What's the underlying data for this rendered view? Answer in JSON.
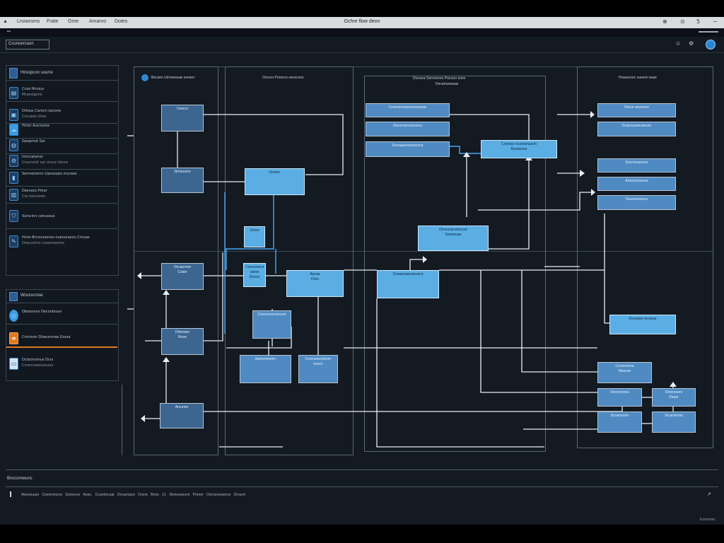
{
  "window": {
    "title": "Ochre flow deon",
    "menu": [
      "Lnowroms",
      "Frate",
      "Ome",
      "Amarvo",
      "Dotes"
    ],
    "controls": [
      "⊕",
      "⊙",
      "5",
      "−"
    ]
  },
  "toolbar": {
    "left_label": "Ccunoercaon",
    "right_icons": [
      "☺",
      "⚙",
      "●"
    ]
  },
  "left_panel": {
    "header": "Hirsopcon sourre",
    "items": [
      {
        "title": "Ccoo Rrcous",
        "sub": "Mraoslgorls",
        "icon": "document-icon"
      },
      {
        "title": "Drtous Carocn socone",
        "sub": "Coruaoo Usos",
        "icon": "file-icon"
      },
      {
        "title": "Hctor Aucnorea",
        "sub": "",
        "icon": "cloud-icon"
      },
      {
        "title": "Geopmot Sor",
        "sub": "",
        "icon": "lock-icon"
      },
      {
        "title": "Ionccatanoc",
        "sub": "Ccuoranlr sar orsus Uenra",
        "icon": "settings-icon"
      },
      {
        "title": "Sermonernn Uanosoeo muraes",
        "sub": "",
        "icon": "tablet-icon"
      },
      {
        "title": "Desnecs Pmor",
        "sub": "Cre loercores",
        "icon": "server-icon"
      },
      {
        "title": "Vurscinn conusous",
        "sub": "",
        "icon": "shield-icon"
      },
      {
        "title": "Hnos Brcsnuoonss nueounaros Cmuas",
        "sub": "Dracoutrio cuoonoeorns",
        "icon": "pen-icon"
      }
    ],
    "section2_header": "Wociocrnoe",
    "section2_items": [
      {
        "title": "Oboonons Oecontsuos",
        "sub": "",
        "icon": "globe-icon"
      },
      {
        "title": "Crortoon Dloeunmaa Grsoa",
        "sub": "",
        "icon": "database-icon",
        "active": true
      },
      {
        "title": "Dctoonomus Dcrs",
        "sub": "Crcennoeocosuos",
        "icon": "folder-icon"
      }
    ]
  },
  "lanes": [
    {
      "title": "Bocsen Umonoaoar sonnec"
    },
    {
      "title": "Ocrvoo Ponocrs oeoscoos"
    },
    {
      "title": "Doceoa Oornoceon Pocoorr sons",
      "sub": "Decamuneaas"
    },
    {
      "title": "Hrasueonc ouoeor oaao"
    }
  ],
  "nodes": [
    {
      "text": "Coerco",
      "text2": ""
    },
    {
      "text": "Nrmocono",
      "text2": ""
    },
    {
      "text": "Occaornne",
      "text2": "Coser"
    },
    {
      "text": "Dlemoan",
      "text2": "Rooe"
    },
    {
      "text": "Arcunno",
      "text2": ""
    },
    {
      "text": "Cnenrc",
      "text2": ""
    },
    {
      "text": "Uorso",
      "text2": ""
    },
    {
      "text": "Conoonoror oaroe",
      "text2": "Dooco"
    },
    {
      "text": "Ascoa",
      "text2": "Doro"
    },
    {
      "text": "Coenrooerracocrs",
      "text2": ""
    },
    {
      "text": "Aanrenmesrc",
      "text2": ""
    },
    {
      "text": "Cormunecontcer nvucn",
      "text2": ""
    },
    {
      "text": "Ccemonoeuneuonuesac",
      "text2": ""
    },
    {
      "text": "Geronoecsnaoocu",
      "text2": ""
    },
    {
      "text": "Gronuareunmscons",
      "text2": ""
    },
    {
      "text": "Crvnoco ncomsmacoh",
      "text2": "Rusaeuoo"
    },
    {
      "text": "Orroucaeunoscoe",
      "text2": "Surveruae"
    },
    {
      "text": "Conoursaeusevoco",
      "text2": ""
    },
    {
      "text": "Nroce eouorore",
      "text2": ""
    },
    {
      "text": "Dcaonuuoevansee",
      "text2": ""
    },
    {
      "text": "Socmuoseono",
      "text2": ""
    },
    {
      "text": "Aelunscmerua",
      "text2": ""
    },
    {
      "text": "Ruuesnoeeca",
      "text2": ""
    },
    {
      "text": "Doonoes recosue",
      "text2": ""
    },
    {
      "text": "Ceonrmona",
      "text2": "Moscee"
    },
    {
      "text": "Dcrrornerus",
      "text2": ""
    },
    {
      "text": "Onnoounnr",
      "text2": "Daaor"
    },
    {
      "text": "Srcarsormo",
      "text2": ""
    }
  ],
  "bottom_panel": {
    "header": "Brocormeunc",
    "status": [
      "Aluesouaer",
      "Coeoromcne",
      "Soosecer",
      "Aeao.",
      "Cruonlocuat",
      "Orcuenacis",
      "Onere",
      "Bnoe",
      "Ct.",
      "Monouseonn",
      "Preoer",
      "Oecrsoeoueroo",
      "Drourer"
    ],
    "right_text": "Eosusnec"
  },
  "colors": {
    "accent": "#4f8ac2",
    "accent_light": "#5aaee4",
    "highlight": "#e07a1f"
  }
}
